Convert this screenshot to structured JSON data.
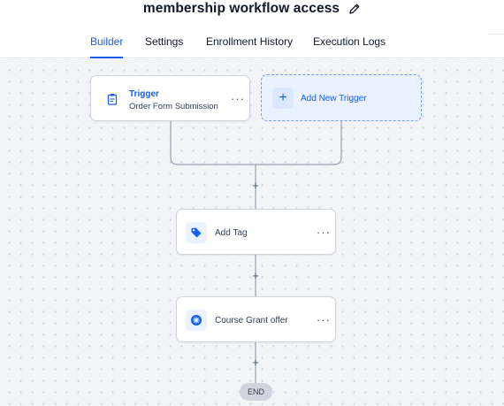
{
  "workflow": {
    "title": "membership workflow access",
    "edit_icon": "pencil-icon"
  },
  "tabs": [
    {
      "label": "Builder",
      "active": true
    },
    {
      "label": "Settings",
      "active": false
    },
    {
      "label": "Enrollment History",
      "active": false
    },
    {
      "label": "Execution Logs",
      "active": false
    }
  ],
  "trigger": {
    "title": "Trigger",
    "subtitle": "Order Form Submission",
    "icon": "clipboard-icon",
    "menu": "···"
  },
  "add_trigger": {
    "label": "Add New Trigger",
    "icon": "plus-icon",
    "symbol": "+"
  },
  "actions": [
    {
      "label": "Add Tag",
      "icon": "tag-icon",
      "menu": "···"
    },
    {
      "label": "Course Grant offer",
      "icon": "course-badge-icon",
      "menu": "···"
    }
  ],
  "plus_symbol": "+",
  "end_label": "END",
  "colors": {
    "accent": "#155eef",
    "canvas": "#f2f4f7",
    "card_border": "#d0d5dd",
    "add_trigger_bg": "#eaf1ff"
  }
}
